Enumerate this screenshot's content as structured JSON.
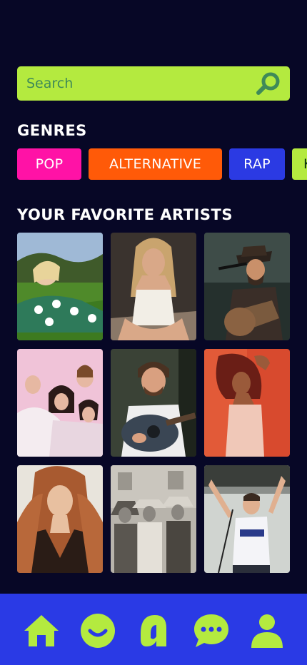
{
  "search": {
    "placeholder": "Search"
  },
  "genres": {
    "title": "GENRES",
    "items": [
      {
        "label": "POP",
        "color": "#ff12a6"
      },
      {
        "label": "ALTERNATIVE",
        "color": "#ff5a08"
      },
      {
        "label": "RAP",
        "color": "#2b3ae3"
      },
      {
        "label": "K",
        "color": "#b4ea3f"
      }
    ]
  },
  "artists": {
    "title": "YOUR FAVORITE ARTISTS",
    "tiles": [
      {
        "icon": "artist-photo-grass-field"
      },
      {
        "icon": "artist-photo-white-top"
      },
      {
        "icon": "artist-photo-guitarist-hat"
      },
      {
        "icon": "artist-photo-band-pink"
      },
      {
        "icon": "artist-photo-acoustic-guitar"
      },
      {
        "icon": "artist-photo-red-background"
      },
      {
        "icon": "artist-photo-red-hair"
      },
      {
        "icon": "artist-photo-band-bw"
      },
      {
        "icon": "artist-photo-stage-singer"
      }
    ]
  },
  "nav": {
    "items": [
      "home-icon",
      "smile-icon",
      "a-logo-icon",
      "chat-icon",
      "profile-icon"
    ],
    "accent": "#b4ea3f",
    "background": "#2a3ae5"
  },
  "theme": {
    "background": "#070726",
    "accent": "#b4ea3f"
  }
}
